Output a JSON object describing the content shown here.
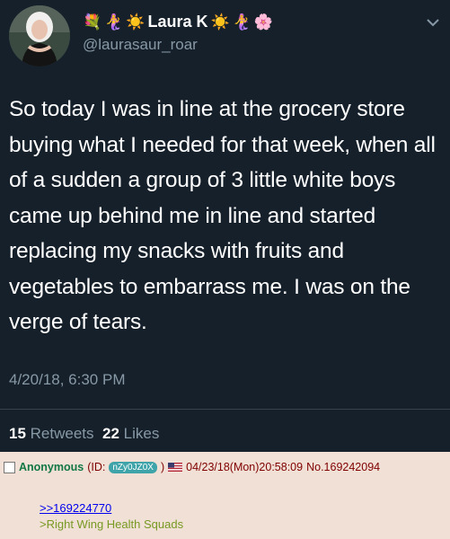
{
  "tweet": {
    "display_name": "Laura K",
    "name_emojis_left": [
      "💐",
      "🧜‍♀️",
      "☀️"
    ],
    "name_emojis_right": [
      "☀️",
      "🧜‍♀️",
      "🌸"
    ],
    "handle": "@laurasaur_roar",
    "text": "So today I was in line at the grocery store buying what I needed for that week, when all of a sudden a group of 3 little white boys came up behind me in line and started replacing my snacks with fruits and vegetables to embarrass me. I was on the verge of tears.",
    "timestamp": "4/20/18, 6:30 PM",
    "retweets_count": "15",
    "retweets_label": "Retweets",
    "likes_count": "22",
    "likes_label": "Likes",
    "colors": {
      "background": "#15202b",
      "muted": "#8899a6",
      "divider": "#38444d"
    }
  },
  "post": {
    "name": "Anonymous",
    "id_prefix": "(ID:",
    "id_value": "nZy0JZ0X",
    "id_suffix": ")",
    "flag_icon": "us-flag-icon",
    "date": "04/23/18(Mon)20:58:09",
    "number_label": "No.169242094",
    "quote_link": ">>169224770",
    "greentext": ">Right Wing Health Squads",
    "colors": {
      "background": "#f0e0d6",
      "name": "#117743",
      "greentext": "#789922",
      "id_badge": "#3ea4a9"
    }
  }
}
